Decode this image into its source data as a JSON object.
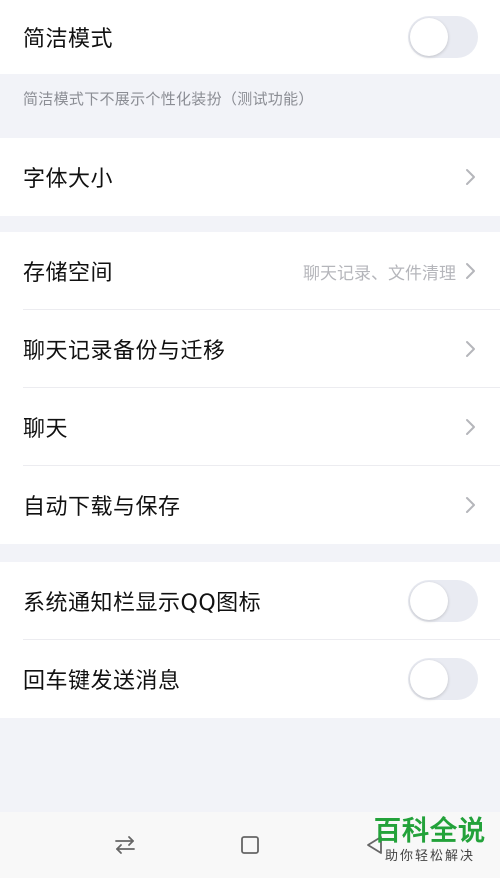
{
  "simple_mode": {
    "label": "简洁模式",
    "enabled": false,
    "hint": "简洁模式下不展示个性化装扮（测试功能）"
  },
  "font_size": {
    "label": "字体大小"
  },
  "storage": {
    "label": "存储空间",
    "value": "聊天记录、文件清理"
  },
  "chat_backup": {
    "label": "聊天记录备份与迁移"
  },
  "chat": {
    "label": "聊天"
  },
  "auto_download": {
    "label": "自动下载与保存"
  },
  "notify_icon": {
    "label": "系统通知栏显示QQ图标",
    "enabled": false
  },
  "enter_send": {
    "label": "回车键发送消息",
    "enabled": false
  },
  "navbar": {
    "buttons": [
      "switch-apps-icon",
      "home-square-icon",
      "back-triangle-icon"
    ]
  },
  "watermark": {
    "title": "百科全说",
    "subtitle": "助你轻松解决"
  },
  "colors": {
    "background": "#f2f3f8",
    "toggle_off": "#e9ebf2",
    "watermark_green": "#23a23a"
  }
}
